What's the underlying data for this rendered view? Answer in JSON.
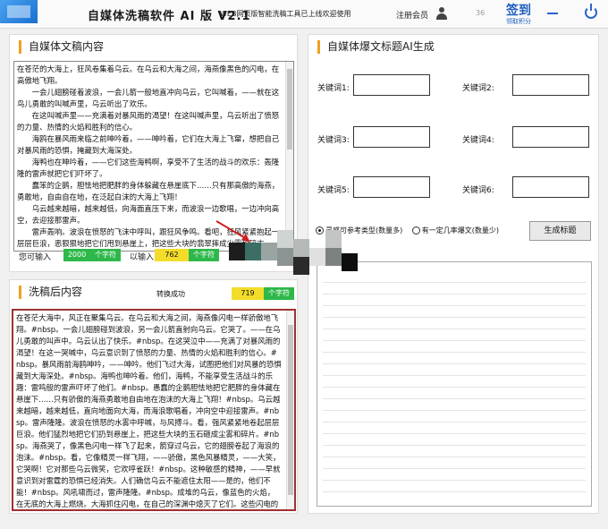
{
  "header": {
    "title": "自媒体洗稿软件 AI 版 V2.1",
    "subtitle": "WEB网页版智能洗稿工具已上线欢迎使用",
    "register": "注册会员",
    "user_num": "36",
    "signin_main": "签到",
    "signin_sub": "领取积分"
  },
  "original": {
    "title": "自媒体文稿内容",
    "text": "在苍茫的大海上，狂风卷集着乌云。在乌云和大海之间，海燕像黑色的闪电，在高傲地飞翔。\n　　一会儿翅膀碰着波浪，一会儿箭一般地直冲向乌云，它叫喊着，——就在这鸟儿勇敢的叫喊声里，乌云听出了欢乐。\n　　在这叫喊声里——充满着对暴风雨的渴望！在这叫喊声里，乌云听出了愤怒的力量、热情的火焰和胜利的信心。\n　　海鸥在暴风雨来临之前呻吟着，——呻吟着，它们在大海上飞窜，想把自己对暴风雨的恐惧，掩藏到大海深处。\n　　海鸭也在呻吟着，——它们这些海鸭啊，享受不了生活的战斗的欢乐：轰隆隆的雷声就把它们吓坏了。\n　　蠢笨的企鹅，胆怯地把肥胖的身体躲藏在悬崖底下……只有那高傲的海燕，勇敢地，自由自在地，在泛起白沫的大海上飞翔！\n　　乌云越来越暗，越来越低，向海面直压下来，而波浪一边歌唱，一边冲向高空，去迎接那雷声。\n　　雷声轰响。波浪在愤怒的飞沫中呼叫，跟狂风争鸣。看吧，狂风紧紧抱起一层层巨浪，恶狠狠地把它们甩到悬崖上，把这些大块的翡翠摔成尘雾和碎末。",
    "can_input_label": "您可输入",
    "can_input_value": "2000",
    "can_input_unit": "个字符",
    "entered_label": "以输入",
    "entered_value": "762",
    "entered_unit": "个字符"
  },
  "result": {
    "title": "洗稿后内容",
    "status": "转换成功",
    "count": "719",
    "count_unit": "个字符",
    "text": "在苍茫大海中，风正在聚集乌云。在乌云和大海之间，海燕像闪电一样骄傲地飞翔。#nbsp。一会儿翅膀碰到波浪，另一会儿箭直射向乌云。它哭了。——在乌儿勇敢的叫声中。乌云认出了快乐。#nbsp。在这哭泣中——充满了对暴风雨的渴望！在这一哭喊中，乌云意识到了愤怒的力量、热情的火焰和胜利的信心。#nbsp。暴风雨前海鸥呻吟，——呻吟。他们飞过大海，试图把他们对风暴的恐惧藏到大海深处。#nbsp。海鸭也呻吟着。他们，海鸭，不能享受生活战斗的乐趣：雷鸣般的雷声吓坏了他们。#nbsp。愚蠢的企鹅胆怯地把它肥胖的身体藏在悬崖下……只有骄傲的海燕勇敢地自由地在泡沫的大海上飞翔！#nbsp。乌云越来越暗，越来越低，直向地面向大海，而海浪歌唱着，冲向空中迎接雷声。#nbsp。雷声隆隆。波浪在愤怒的水雾中呼喊，与风搏斗。看，强风紧紧地卷起层层巨浪。他们猛烈地把它们扔到悬崖上，把这些大块的玉石砸成尘雾和碎片。#nbsp。海燕哭了，像黑色闪电一样飞了起来，箭穿过乌云，它的翅膀卷起了海浪的泡沫。#nbsp。看，它像精灵一样飞翔，——骄傲，黑色风暴精灵，——大笑，它哭啊！它对那些乌云微笑，它欢呼雀跃！#nbsp。这种敏感的精神，——早就意识到对雷霆的恐惧已经消失。人们确信乌云不能遮住太阳——是的，他们不能！#nbsp。风吼啸而过，雷声隆隆。#nbsp。成堆的乌云，像蓝色的火焰，在无底的大海上燃烧。大海抓住闪电，在自己的深渊中熄灭了它们。这些闪电的影子就像蛇蜂一样，在海里扭动，消失了。"
  },
  "generator": {
    "title": "自媒体爆文标题AI生成",
    "kw1": "关键词1:",
    "kw2": "关键词2:",
    "kw3": "关键词3:",
    "kw4": "关键词4:",
    "kw5": "关键词5:",
    "kw6": "关键词6:",
    "radio1": "灵感可参考类型(数量多)",
    "radio2": "有一定几率爆文(数量少)",
    "button": "生成标题"
  },
  "colors": {
    "accent_orange": "#f0a020",
    "green": "#2eb84a",
    "yellow": "#f3dc2a",
    "result_border": "#a03030",
    "brand_blue": "#1f5fbf"
  }
}
